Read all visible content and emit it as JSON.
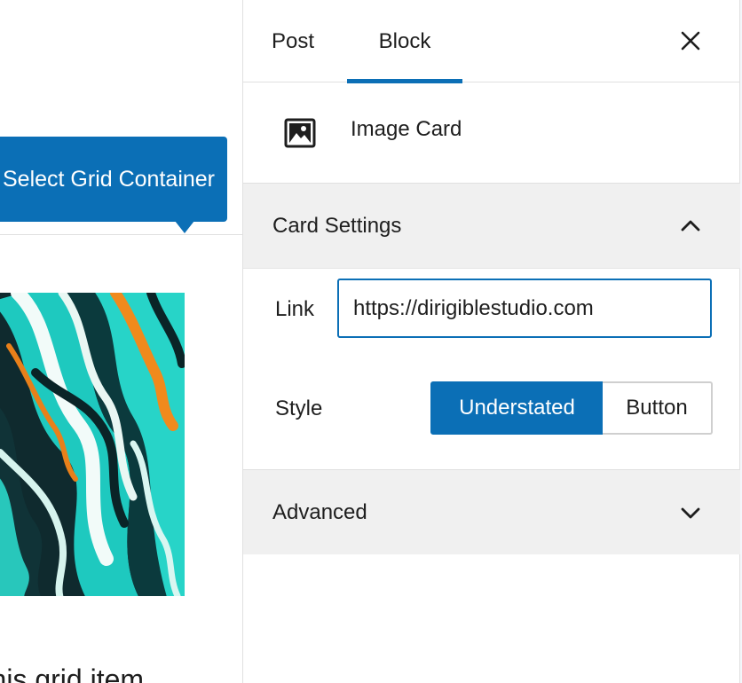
{
  "canvas": {
    "tooltip": "Select Grid Container",
    "caption": "This grid item"
  },
  "sidebar": {
    "tabs": [
      {
        "label": "Post",
        "active": false
      },
      {
        "label": "Block",
        "active": true
      }
    ],
    "close_icon": "close-icon",
    "block": {
      "icon": "image-icon",
      "title": "Image Card"
    },
    "card_settings": {
      "title": "Card Settings",
      "expanded": true,
      "link": {
        "label": "Link",
        "value": "https://dirigiblestudio.com"
      },
      "style": {
        "label": "Style",
        "options": [
          {
            "label": "Understated",
            "selected": true
          },
          {
            "label": "Button",
            "selected": false
          }
        ]
      }
    },
    "advanced": {
      "title": "Advanced",
      "expanded": false
    }
  },
  "colors": {
    "accent": "#0b6fb6",
    "panel_bg": "#f0f0f0",
    "border": "#e0e0e0"
  }
}
